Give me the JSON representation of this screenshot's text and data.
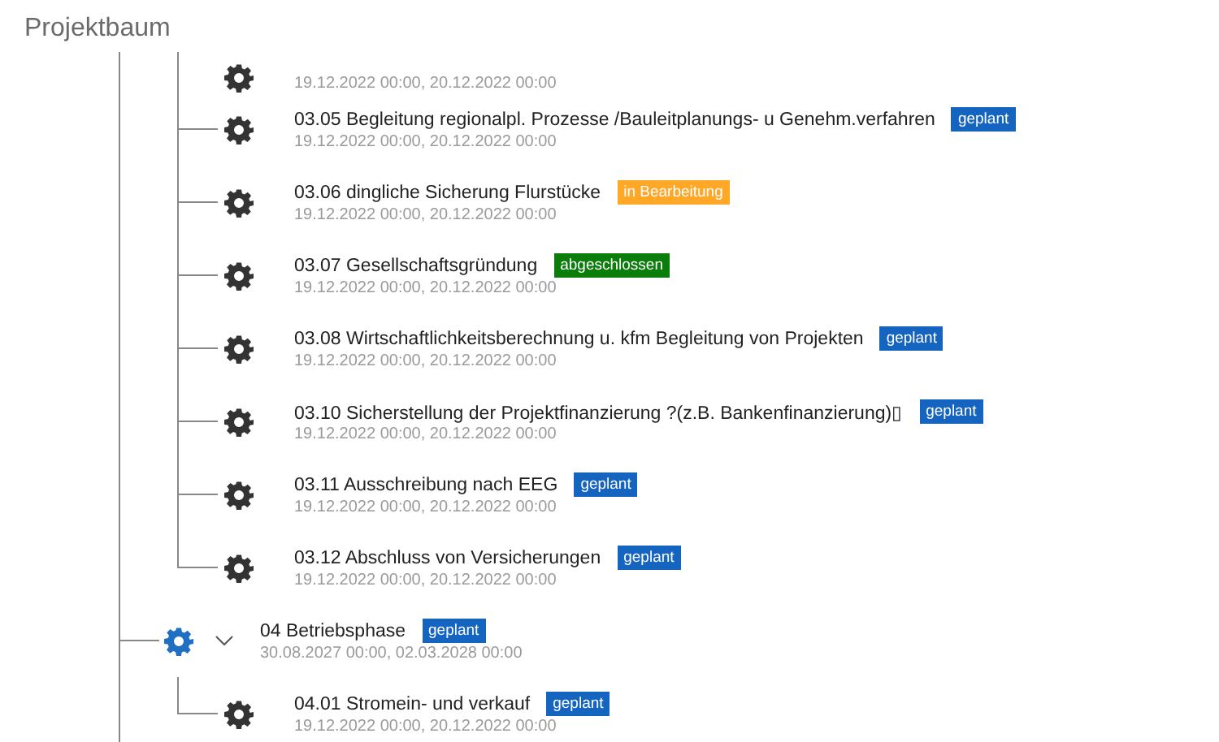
{
  "title": "Projektbaum",
  "tree": [
    {
      "children": [
        {
          "dates": "19.12.2022 00:00, 20.12.2022 00:00"
        },
        {
          "title": "03.05 Begleitung regionalpl. Prozesse /Bauleitplanungs- u Genehm.verfahren",
          "status": "geplant",
          "color": "#1565c0",
          "dates": "19.12.2022 00:00, 20.12.2022 00:00"
        },
        {
          "title": "03.06 dingliche Sicherung Flurstücke",
          "status": "in Bearbeitung",
          "color": "#ffa726",
          "dates": "19.12.2022 00:00, 20.12.2022 00:00"
        },
        {
          "title": "03.07 Gesellschaftsgründung",
          "status": "abgeschlossen",
          "color": "#0b7d0b",
          "dates": "19.12.2022 00:00, 20.12.2022 00:00"
        },
        {
          "title": "03.08 Wirtschaftlichkeitsberechnung u. kfm Begleitung von Projekten",
          "status": "geplant",
          "color": "#1565c0",
          "dates": "19.12.2022 00:00, 20.12.2022 00:00"
        },
        {
          "title": "03.10 Sicherstellung der Projektfinanzierung ?(z.B. Bankenfinanzierung)▯",
          "status": "geplant",
          "color": "#1565c0",
          "dates": "19.12.2022 00:00, 20.12.2022 00:00"
        },
        {
          "title": "03.11 Ausschreibung nach EEG",
          "status": "geplant",
          "color": "#1565c0",
          "dates": "19.12.2022 00:00, 20.12.2022 00:00"
        },
        {
          "title": "03.12 Abschluss von Versicherungen",
          "status": "geplant",
          "color": "#1565c0",
          "dates": "19.12.2022 00:00, 20.12.2022 00:00"
        }
      ]
    },
    {
      "title": "04 Betriebsphase",
      "status": "geplant",
      "color": "#1565c0",
      "dates": "30.08.2027 00:00, 02.03.2028 00:00",
      "expanded": true,
      "children": [
        {
          "title": "04.01 Stromein- und verkauf",
          "status": "geplant",
          "color": "#1565c0",
          "dates": "19.12.2022 00:00, 20.12.2022 00:00"
        }
      ]
    }
  ]
}
